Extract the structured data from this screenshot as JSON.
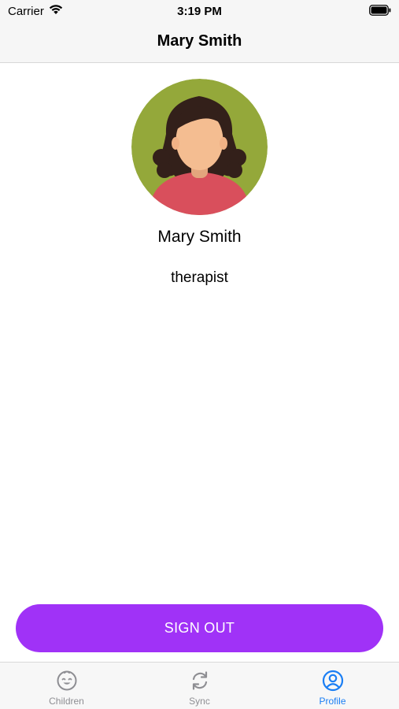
{
  "status_bar": {
    "carrier": "Carrier",
    "time": "3:19 PM",
    "wifi_icon": "wifi-icon",
    "battery_icon": "battery-icon"
  },
  "nav": {
    "title": "Mary Smith"
  },
  "profile": {
    "avatar_icon": "woman-avatar",
    "name": "Mary Smith",
    "role": "therapist"
  },
  "actions": {
    "sign_out_label": "SIGN OUT"
  },
  "tab_bar": {
    "tabs": [
      {
        "label": "Children",
        "icon": "baby-face-icon",
        "active": false
      },
      {
        "label": "Sync",
        "icon": "sync-icon",
        "active": false
      },
      {
        "label": "Profile",
        "icon": "profile-icon",
        "active": true
      }
    ]
  },
  "colors": {
    "accent": "#a032f7",
    "tab_active": "#1a7ef4",
    "tab_inactive": "#8e8e93",
    "avatar_background": "#94a83a"
  }
}
